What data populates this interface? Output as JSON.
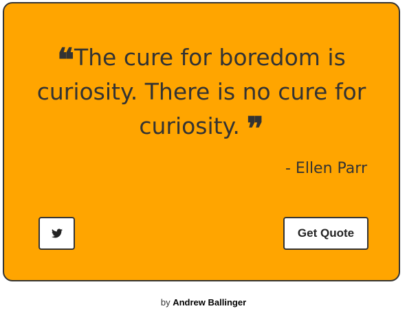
{
  "colors": {
    "card_background": "#ffa500",
    "text": "#333333",
    "button_background": "#ffffff"
  },
  "quote": {
    "open_mark": "❝",
    "text": "The cure for boredom is curiosity. There is no cure for curiosity.",
    "close_mark": "❞",
    "author": "- Ellen Parr"
  },
  "buttons": {
    "tweet_icon": "twitter-icon",
    "get_quote_label": "Get Quote"
  },
  "footer": {
    "prefix": "by",
    "author_name": "Andrew Ballinger"
  }
}
